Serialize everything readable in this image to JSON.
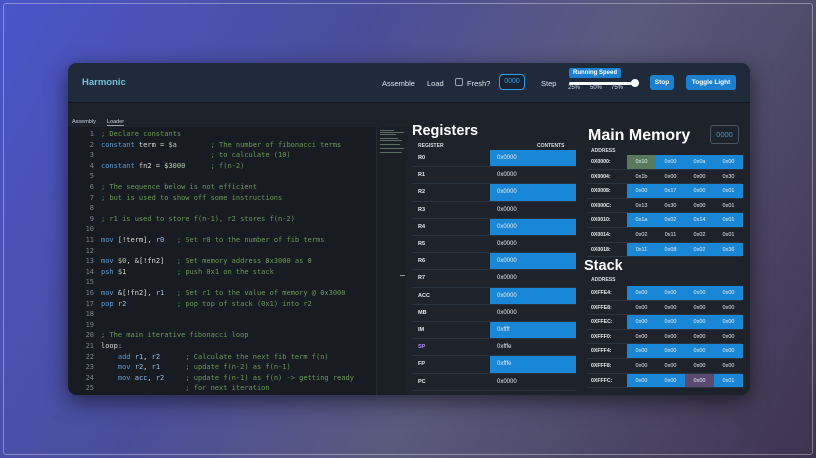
{
  "app": {
    "title": "Harmonic"
  },
  "toolbar": {
    "assemble": "Assemble",
    "load": "Load",
    "fresh": "Fresh?",
    "input_value": "0000",
    "step": "Step",
    "running_speed": "Running Speed",
    "speed_ticks": [
      "25%",
      "50%",
      "75%"
    ],
    "speed_value": 95,
    "stop": "Stop",
    "toggle_light": "Toggle Light"
  },
  "tabs": [
    "Assembly",
    "Loader"
  ],
  "editor": {
    "lines": [
      {
        "n": "1",
        "code": "; Declare constants"
      },
      {
        "n": "2",
        "code": "constant term = $a        ; The number of fibonacci terms"
      },
      {
        "n": "3",
        "code": "                          ; to calculate (10)"
      },
      {
        "n": "4",
        "code": "constant fn2 = $3000      ; f(n-2)"
      },
      {
        "n": "5",
        "code": ""
      },
      {
        "n": "6",
        "code": "; The sequence below is not efficient"
      },
      {
        "n": "7",
        "code": "; but is used to show off some instructions"
      },
      {
        "n": "8",
        "code": ""
      },
      {
        "n": "9",
        "code": "; r1 is used to store f(n-1), r2 stores f(n-2)"
      },
      {
        "n": "10",
        "code": ""
      },
      {
        "n": "11",
        "code": "mov [!term], r0   ; Set r0 to the number of fib terms"
      },
      {
        "n": "12",
        "code": ""
      },
      {
        "n": "13",
        "code": "mov $0, &[!fn2]   ; Set memory address 0x3000 as 0"
      },
      {
        "n": "14",
        "code": "psh $1            ; push 0x1 on the stack"
      },
      {
        "n": "15",
        "code": ""
      },
      {
        "n": "16",
        "code": "mov &[!fn2], r1   ; Set r1 to the value of memory @ 0x3000"
      },
      {
        "n": "17",
        "code": "pop r2            ; pop top of stack (0x1) into r2"
      },
      {
        "n": "18",
        "code": ""
      },
      {
        "n": "19",
        "code": ""
      },
      {
        "n": "20",
        "code": "; The main iterative fibonacci loop"
      },
      {
        "n": "21",
        "code": "loop:"
      },
      {
        "n": "22",
        "code": "    add r1, r2      ; Calculate the next fib term f(n)"
      },
      {
        "n": "23",
        "code": "    mov r2, r1      ; update f(n-2) as f(n-1)"
      },
      {
        "n": "24",
        "code": "    mov acc, r2     ; update f(n-1) as f(n) -> getting ready"
      },
      {
        "n": "25",
        "code": "                    ; for next iteration"
      }
    ]
  },
  "registers": {
    "title": "Registers",
    "col_register": "REGISTER",
    "col_contents": "CONTENTS",
    "rows": [
      {
        "name": "R0",
        "value": "0x0000",
        "hl": true
      },
      {
        "name": "R1",
        "value": "0x0000",
        "hl": false
      },
      {
        "name": "R2",
        "value": "0x0000",
        "hl": true
      },
      {
        "name": "R3",
        "value": "0x0000",
        "hl": false
      },
      {
        "name": "R4",
        "value": "0x0000",
        "hl": true
      },
      {
        "name": "R5",
        "value": "0x0000",
        "hl": false
      },
      {
        "name": "R6",
        "value": "0x0000",
        "hl": true
      },
      {
        "name": "R7",
        "value": "0x0000",
        "hl": false
      },
      {
        "name": "ACC",
        "value": "0x0000",
        "hl": true
      },
      {
        "name": "MB",
        "value": "0x0000",
        "hl": false
      },
      {
        "name": "IM",
        "value": "0xffff",
        "hl": true
      },
      {
        "name": "SP",
        "value": "0xfffe",
        "hl": false,
        "purple": true
      },
      {
        "name": "FP",
        "value": "0xfffe",
        "hl": true
      },
      {
        "name": "PC",
        "value": "0x0000",
        "hl": false
      }
    ]
  },
  "memory": {
    "title": "Main Memory",
    "address_label": "ADDRESS",
    "address_input": "0000",
    "rows": [
      {
        "addr": "0X0000:",
        "cells": [
          "0x10",
          "0x00",
          "0x0a",
          "0x00"
        ]
      },
      {
        "addr": "0X0004:",
        "cells": [
          "0x1b",
          "0x00",
          "0x00",
          "0x30"
        ]
      },
      {
        "addr": "0X0008:",
        "cells": [
          "0x00",
          "0x17",
          "0x00",
          "0x01"
        ]
      },
      {
        "addr": "0X000C:",
        "cells": [
          "0x13",
          "0x30",
          "0x00",
          "0x01"
        ]
      },
      {
        "addr": "0X0010:",
        "cells": [
          "0x1a",
          "0x02",
          "0x14",
          "0x01"
        ]
      },
      {
        "addr": "0X0014:",
        "cells": [
          "0x02",
          "0x11",
          "0x02",
          "0x01"
        ]
      },
      {
        "addr": "0X0018:",
        "cells": [
          "0x11",
          "0x08",
          "0x02",
          "0x36"
        ]
      }
    ]
  },
  "stack": {
    "title": "Stack",
    "address_label": "ADDRESS",
    "rows": [
      {
        "addr": "0XFFE4:",
        "cells": [
          "0x00",
          "0x00",
          "0x00",
          "0x00"
        ]
      },
      {
        "addr": "0XFFE8:",
        "cells": [
          "0x00",
          "0x00",
          "0x00",
          "0x00"
        ]
      },
      {
        "addr": "0XFFEC:",
        "cells": [
          "0x00",
          "0x00",
          "0x00",
          "0x00"
        ]
      },
      {
        "addr": "0XFFF0:",
        "cells": [
          "0x00",
          "0x00",
          "0x00",
          "0x00"
        ]
      },
      {
        "addr": "0XFFF4:",
        "cells": [
          "0x00",
          "0x00",
          "0x00",
          "0x00"
        ]
      },
      {
        "addr": "0XFFF8:",
        "cells": [
          "0x00",
          "0x00",
          "0x00",
          "0x00"
        ]
      },
      {
        "addr": "0XFFFC:",
        "cells": [
          "0x00",
          "0x00",
          "0x00",
          "0x01"
        ]
      }
    ]
  },
  "colors": {
    "accent": "#1c7fd0",
    "highlight": "#1a86d6",
    "pc_cell": "#5a7a5e",
    "sp_cell": "#5a4a70"
  }
}
